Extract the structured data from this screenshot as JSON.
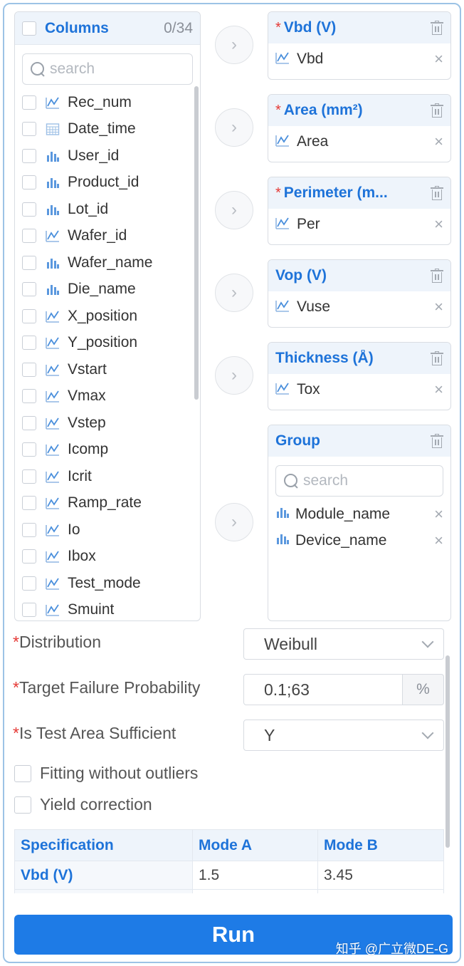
{
  "columns": {
    "title": "Columns",
    "count": "0/34",
    "search_placeholder": "search",
    "items": [
      {
        "label": "Rec_num",
        "icon": "line-chart-icon"
      },
      {
        "label": "Date_time",
        "icon": "calendar-icon"
      },
      {
        "label": "User_id",
        "icon": "bar-chart-icon"
      },
      {
        "label": "Product_id",
        "icon": "bar-chart-icon"
      },
      {
        "label": "Lot_id",
        "icon": "bar-chart-icon"
      },
      {
        "label": "Wafer_id",
        "icon": "line-chart-icon"
      },
      {
        "label": "Wafer_name",
        "icon": "bar-chart-icon"
      },
      {
        "label": "Die_name",
        "icon": "bar-chart-icon"
      },
      {
        "label": "X_position",
        "icon": "line-chart-icon"
      },
      {
        "label": "Y_position",
        "icon": "line-chart-icon"
      },
      {
        "label": "Vstart",
        "icon": "line-chart-icon"
      },
      {
        "label": "Vmax",
        "icon": "line-chart-icon"
      },
      {
        "label": "Vstep",
        "icon": "line-chart-icon"
      },
      {
        "label": "Icomp",
        "icon": "line-chart-icon"
      },
      {
        "label": "Icrit",
        "icon": "line-chart-icon"
      },
      {
        "label": "Ramp_rate",
        "icon": "line-chart-icon"
      },
      {
        "label": "Io",
        "icon": "line-chart-icon"
      },
      {
        "label": "Ibox",
        "icon": "line-chart-icon"
      },
      {
        "label": "Test_mode",
        "icon": "line-chart-icon"
      },
      {
        "label": "Smuint",
        "icon": "line-chart-icon"
      }
    ]
  },
  "arrow_glyph": "›",
  "targets": [
    {
      "title": "Vbd (V)",
      "required": true,
      "item": "Vbd"
    },
    {
      "title": "Area (mm²)",
      "required": true,
      "item": "Area"
    },
    {
      "title": "Perimeter (m...",
      "required": true,
      "item": "Per"
    },
    {
      "title": "Vop (V)",
      "required": false,
      "item": "Vuse"
    },
    {
      "title": "Thickness (Å)",
      "required": false,
      "item": "Tox"
    }
  ],
  "required_mark": "*",
  "remove_glyph": "×",
  "group": {
    "title": "Group",
    "search_placeholder": "search",
    "items": [
      "Module_name",
      "Device_name"
    ]
  },
  "form": {
    "distribution_label": "Distribution",
    "distribution_value": "Weibull",
    "target_failure_label": "Target Failure Probability",
    "target_failure_value": "0.1;63",
    "target_failure_unit": "%",
    "test_area_label": "Is Test Area Sufficient",
    "test_area_value": "Y",
    "fitting_label": "Fitting without outliers",
    "yield_label": "Yield correction"
  },
  "spec_table": {
    "headers": [
      "Specification",
      "Mode A",
      "Mode B"
    ],
    "rows": [
      [
        "Vbd (V)",
        "1.5",
        "3.45"
      ]
    ]
  },
  "run_label": "Run",
  "watermark": "知乎 @广立微DE-G",
  "colors": {
    "accent": "#1e73d9",
    "required": "#e53935",
    "run_button": "#1e7be6",
    "border": "#9cc3e6"
  }
}
